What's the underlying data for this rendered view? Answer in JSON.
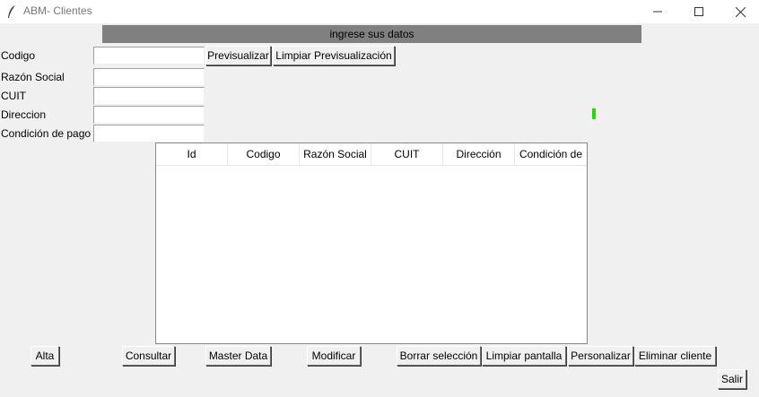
{
  "window": {
    "title": "ABM- Clientes",
    "icon": "feather-icon",
    "minimize_icon": "minimize-icon",
    "maximize_icon": "maximize-icon",
    "close_icon": "close-icon"
  },
  "banner": {
    "text": "ingrese sus datos",
    "color": "#808080"
  },
  "form": {
    "codigo_label": "Codigo",
    "razon_social_label": "Razón Social",
    "cuit_label": "CUIT",
    "direccion_label": "Direccion",
    "condicion_pago_label": "Condición de pago",
    "codigo_value": "",
    "razon_social_value": "",
    "cuit_value": "",
    "direccion_value": "",
    "condicion_pago_value": ""
  },
  "preview": {
    "previsualizar_label": "Previsualizar",
    "limpiar_previsualizacion_label": "Limpiar Previsualización"
  },
  "indicator": {
    "color": "#22dd00"
  },
  "table": {
    "columns": [
      "Id",
      "Codigo",
      "Razón Social",
      "CUIT",
      "Dirección",
      "Condición de"
    ],
    "rows": []
  },
  "actions": {
    "alta": "Alta",
    "consultar": "Consultar",
    "master_data": "Master Data",
    "modificar": "Modificar",
    "borrar_seleccion": "Borrar selección",
    "limpiar_pantalla": "Limpiar pantalla",
    "personalizar": "Personalizar",
    "eliminar_cliente": "Eliminar cliente",
    "salir": "Salir"
  }
}
